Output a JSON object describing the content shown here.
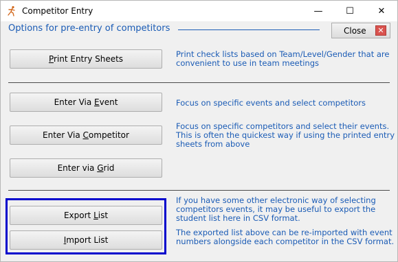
{
  "window": {
    "title": "Competitor Entry",
    "controls": {
      "minimize": "—",
      "maximize": "☐",
      "close": "✕"
    }
  },
  "header": {
    "heading": "Options for pre-entry of competitors",
    "close_label": "Close"
  },
  "sections": {
    "print": {
      "button": {
        "pre": "",
        "accel": "P",
        "post": "rint Entry Sheets"
      },
      "description": "Print check lists based on Team/Level/Gender that are convenient to use in team meetings"
    },
    "event": {
      "button": {
        "pre": "Enter Via ",
        "accel": "E",
        "post": "vent"
      },
      "description": "Focus on specific events and select competitors"
    },
    "competitor": {
      "button": {
        "pre": "Enter Via ",
        "accel": "C",
        "post": "ompetitor"
      },
      "description": "Focus on specific competitors and select their events.   This is often the quickest way if using the printed entry sheets from above"
    },
    "grid": {
      "button": {
        "pre": "Enter via ",
        "accel": "G",
        "post": "rid"
      }
    },
    "export": {
      "button": {
        "pre": "Export ",
        "accel": "L",
        "post": "ist"
      },
      "description": "If you have some other electronic way of selecting competitors events, it may be useful to export the student list here in CSV format."
    },
    "import": {
      "button": {
        "pre": "",
        "accel": "I",
        "post": "mport List"
      },
      "description": "The exported list above can be re-imported with event numbers alongside each competitor in the CSV format."
    }
  },
  "colors": {
    "accent_text": "#1a5bb5",
    "highlight_border": "#0000cc",
    "close_icon": "#d9534f"
  }
}
